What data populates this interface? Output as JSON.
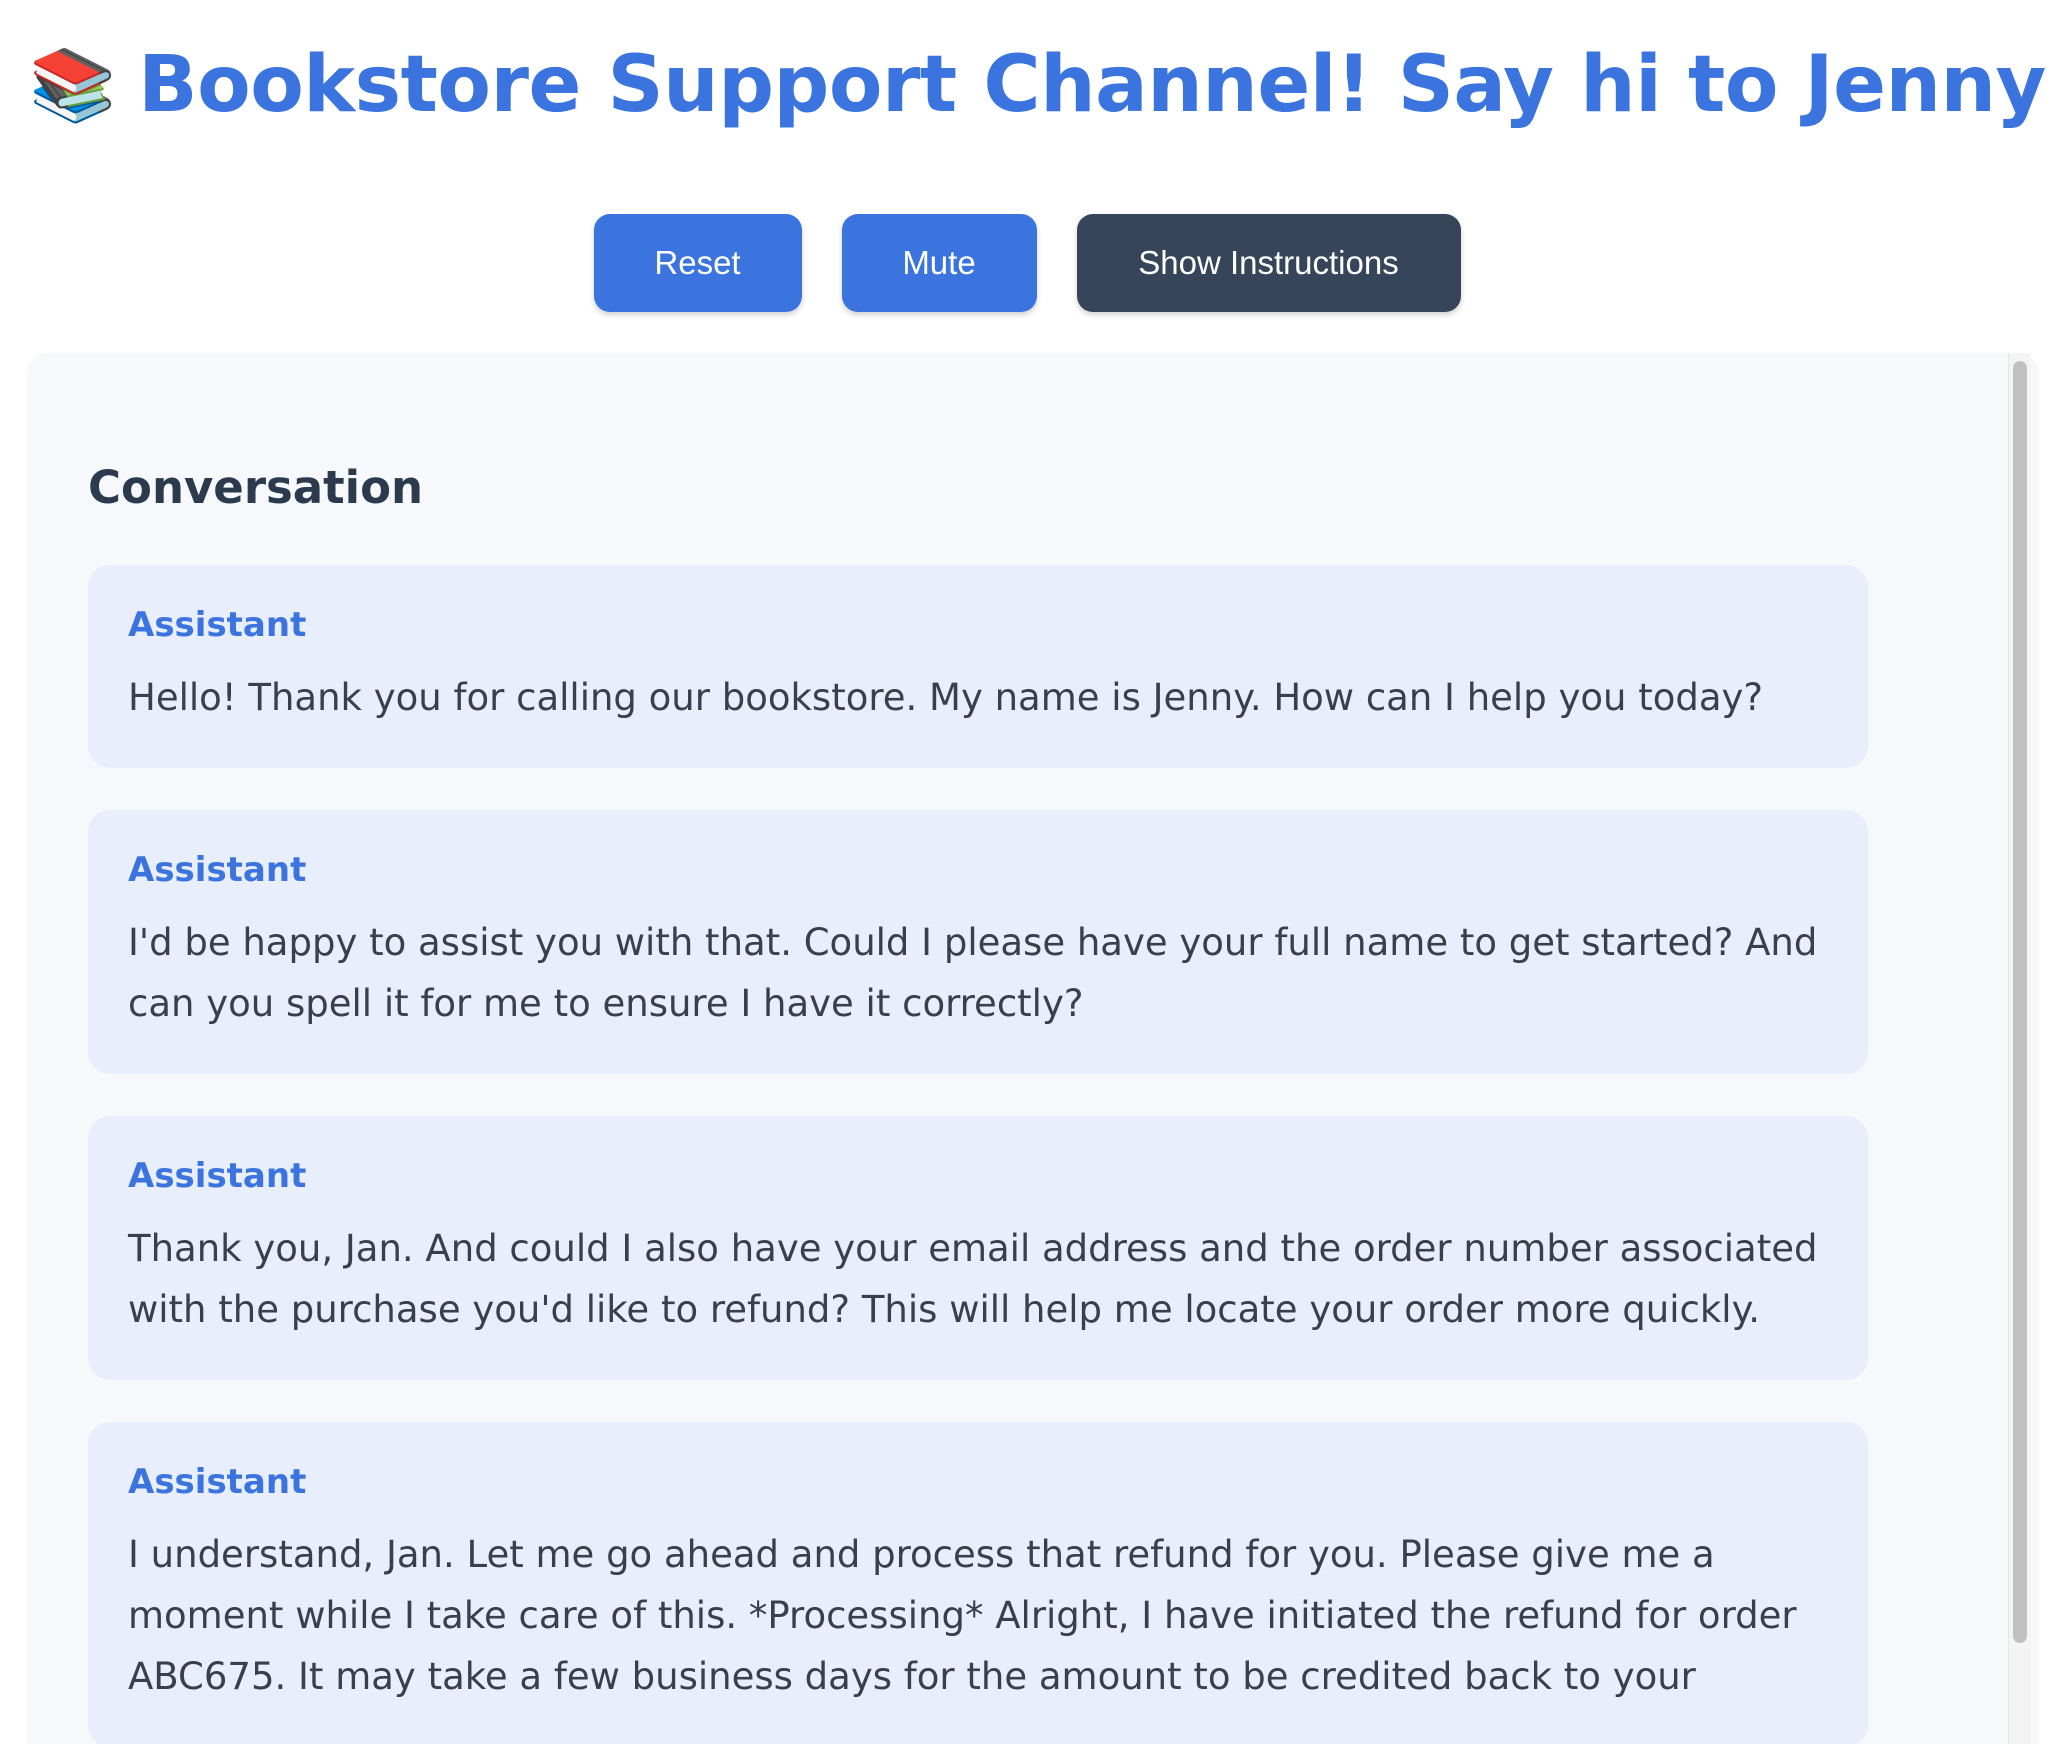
{
  "header": {
    "icon_left": "📚",
    "title": "Bookstore Support Channel! Say hi to Jenny",
    "icon_wave": "👋",
    "icon_robot": "🤖"
  },
  "toolbar": {
    "reset_label": "Reset",
    "mute_label": "Mute",
    "instructions_label": "Show Instructions"
  },
  "conversation": {
    "heading": "Conversation",
    "messages": [
      {
        "role": "Assistant",
        "text": "Hello! Thank you for calling our bookstore. My name is Jenny. How can I help you today?"
      },
      {
        "role": "Assistant",
        "text": "I'd be happy to assist you with that. Could I please have your full name to get started? And can you spell it for me to ensure I have it correctly?"
      },
      {
        "role": "Assistant",
        "text": "Thank you, Jan. And could I also have your email address and the order number associated with the purchase you'd like to refund? This will help me locate your order more quickly."
      },
      {
        "role": "Assistant",
        "text": "I understand, Jan. Let me go ahead and process that refund for you. Please give me a moment while I take care of this. *Processing* Alright, I have initiated the refund for order ABC675. It may take a few business days for the amount to be credited back to your"
      }
    ]
  },
  "colors": {
    "accent": "#3b74df",
    "dark_button": "#364559",
    "panel_bg": "#f6f8fb",
    "message_bg": "#e8eefc"
  }
}
